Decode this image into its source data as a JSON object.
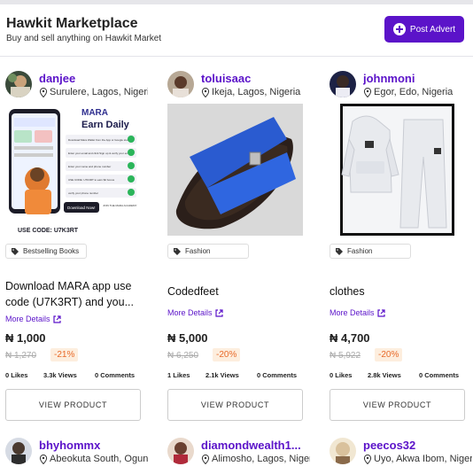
{
  "header": {
    "title": "Hawkit Marketplace",
    "subtitle": "Buy and sell anything on Hawkit Market",
    "post_button": "Post Advert"
  },
  "colors": {
    "brand": "#5b13c9",
    "discount": "#e86a2a"
  },
  "products": [
    {
      "username": "danjee",
      "location": "Surulere, Lagos, Nigeria",
      "category": "Bestselling Books",
      "name": "Download MARA app use code (U7K3RT) and you...",
      "more": "More Details",
      "price": "₦ 1,000",
      "old_price": "₦ 1,270",
      "discount": "-21%",
      "likes": "0 Likes",
      "views": "3.3k Views",
      "comments": "0 Comments",
      "button": "VIEW PRODUCT",
      "image": {
        "earn_title": "MARA",
        "earn_sub": "Earn Daily",
        "steps": [
          "Download Mara Wallet from the App or Google store",
          "Enter your email and click Sign up & verify your email",
          "Enter your name and phone number",
          "USE CODE: U7K3RT to earn $2 bonus",
          "verify your phone number"
        ],
        "download": "Download Now!",
        "code": "USE CODE: U7K3RT",
        "join": "JOIN THE MARA ACADEMY"
      }
    },
    {
      "username": "toluisaac",
      "location": "Ikeja, Lagos, Nigeria",
      "category": "Fashion",
      "name": "Codedfeet",
      "more": "More Details",
      "price": "₦ 5,000",
      "old_price": "₦ 6,250",
      "discount": "-20%",
      "likes": "1 Likes",
      "views": "2.1k Views",
      "comments": "0 Comments",
      "button": "VIEW PRODUCT"
    },
    {
      "username": "johnmoni",
      "location": "Egor, Edo, Nigeria",
      "category": "Fashion",
      "name": "clothes",
      "more": "More Details",
      "price": "₦ 4,700",
      "old_price": "₦ 5,922",
      "discount": "-20%",
      "likes": "0 Likes",
      "views": "2.8k Views",
      "comments": "0 Comments",
      "button": "VIEW PRODUCT"
    }
  ],
  "next_row": [
    {
      "username": "bhyhommx",
      "location": "Abeokuta South, Ogun"
    },
    {
      "username": "diamondwealth1...",
      "location": "Alimosho, Lagos, Nigeria"
    },
    {
      "username": "peecos32",
      "location": "Uyo, Akwa Ibom, Nigeria"
    }
  ]
}
